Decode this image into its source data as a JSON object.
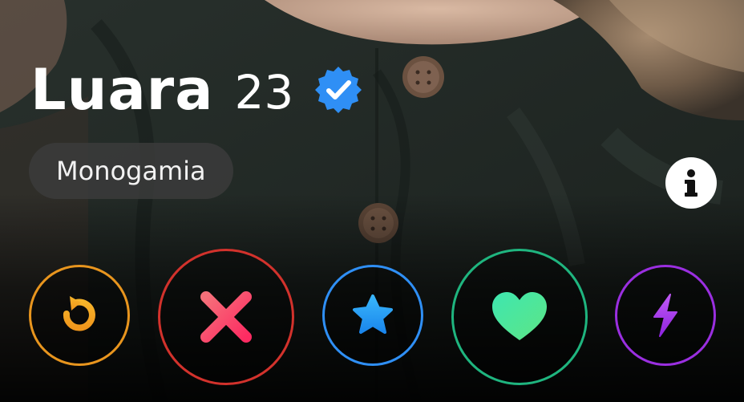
{
  "profile": {
    "name": "Luara",
    "age": "23",
    "verified_icon": "verified-badge-icon",
    "tag": "Monogamia"
  },
  "icons": {
    "info": "info-icon",
    "rewind": "rewind-icon",
    "nope": "close-icon",
    "super_like": "star-icon",
    "like": "heart-icon",
    "boost": "lightning-icon"
  },
  "colors": {
    "verified": "#2f8ff5",
    "rewind": "#f2a51c",
    "nope_start": "#f35a6e",
    "nope_end": "#fd2b62",
    "super_like": "#2fa6f5",
    "like_start": "#2ee3a4",
    "like_end": "#5fe67f",
    "boost": "#a53cf0"
  }
}
